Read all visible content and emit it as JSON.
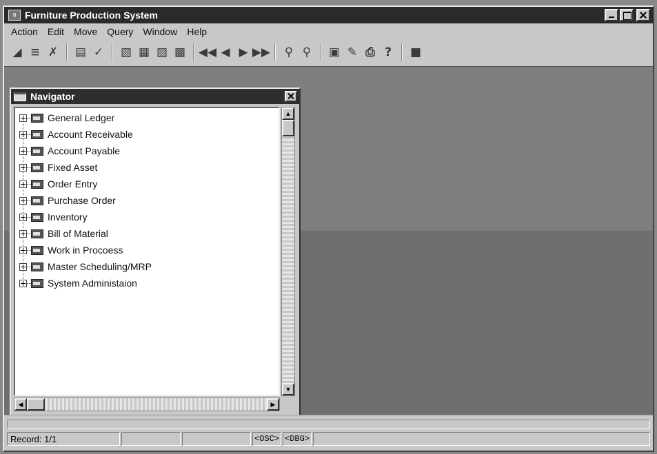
{
  "window": {
    "title": "Furniture Production System",
    "app_icon_text": "ฮ"
  },
  "menu": [
    "Action",
    "Edit",
    "Move",
    "Query",
    "Window",
    "Help"
  ],
  "toolbar": {
    "groups": [
      [
        "new-record-icon",
        "insert-icon",
        "delete-icon"
      ],
      [
        "save-icon",
        "check-icon"
      ],
      [
        "form-icon",
        "report-icon",
        "list-icon",
        "lookup-icon"
      ],
      [
        "first-record-icon",
        "previous-record-icon",
        "next-record-icon",
        "last-record-icon"
      ],
      [
        "find-icon",
        "find-next-icon"
      ],
      [
        "properties-icon",
        "print-preview-icon",
        "print-icon",
        "help-icon"
      ],
      [
        "exit-icon"
      ]
    ]
  },
  "navigator": {
    "title": "Navigator",
    "items": [
      "General Ledger",
      "Account Receivable",
      "Account Payable",
      "Fixed Asset",
      "Order Entry",
      "Purchase Order",
      "Inventory",
      "Bill of Material",
      "Work in Procoess",
      "Master Scheduling/MRP",
      "System Administaion"
    ]
  },
  "status": {
    "record": "Record: 1/1",
    "osc": "<OSC>",
    "dbg": "<DBG>"
  }
}
